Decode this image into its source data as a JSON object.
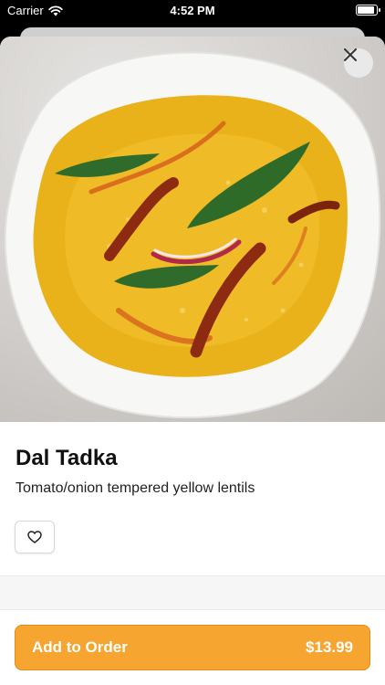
{
  "status_bar": {
    "carrier": "Carrier",
    "time": "4:52 PM"
  },
  "item": {
    "name": "Dal Tadka",
    "description": "Tomato/onion tempered yellow lentils",
    "image_subject": "dal-tadka-photo"
  },
  "order_button": {
    "label": "Add to Order",
    "price": "$13.99"
  },
  "colors": {
    "accent": "#f6a531",
    "accent_border": "#e08d1a"
  }
}
